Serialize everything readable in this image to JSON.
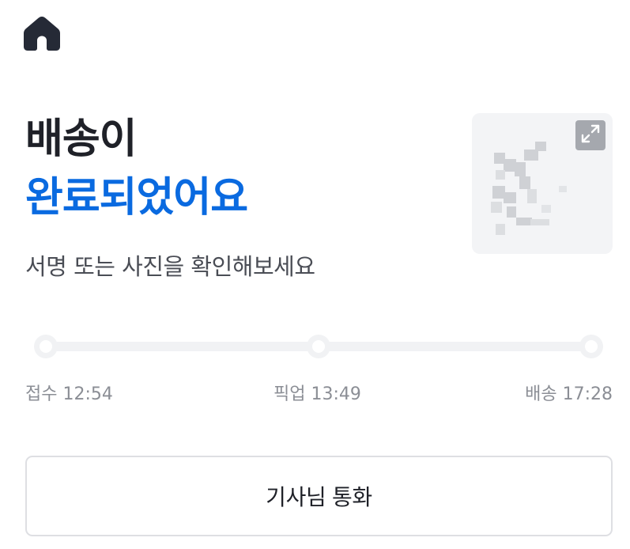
{
  "header": {
    "home_icon": "home-icon"
  },
  "status": {
    "title_line1": "배송이",
    "title_line2": "완료되었어요",
    "subtitle": "서명 또는 사진을 확인해보세요",
    "title_color": "#1f2128",
    "accent_color": "#0a6ae0"
  },
  "proof": {
    "thumbnail_icon": "signature-image",
    "expand_icon": "expand-icon"
  },
  "timeline": {
    "steps": [
      {
        "label": "접수 12:54"
      },
      {
        "label": "픽업 13:49"
      },
      {
        "label": "배송 17:28"
      }
    ]
  },
  "actions": {
    "call_driver_label": "기사님 통화"
  }
}
